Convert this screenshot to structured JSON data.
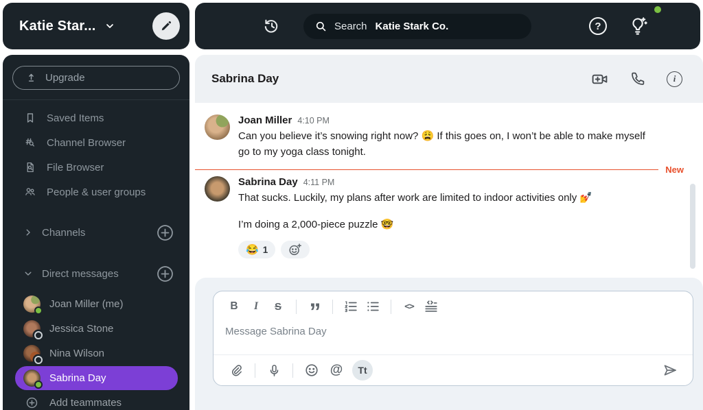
{
  "workspace": {
    "name": "Katie Star..."
  },
  "topbar": {
    "search_label": "Search",
    "search_context": "Katie Stark Co.",
    "help_glyph": "?"
  },
  "sidebar": {
    "upgrade": "Upgrade",
    "items": [
      {
        "label": "Saved Items"
      },
      {
        "label": "Channel Browser"
      },
      {
        "label": "File Browser"
      },
      {
        "label": "People & user groups"
      }
    ],
    "channels_label": "Channels",
    "dms_label": "Direct messages",
    "dms": [
      {
        "name": "Joan Miller (me)",
        "status": "online"
      },
      {
        "name": "Jessica Stone",
        "status": "offline"
      },
      {
        "name": "Nina Wilson",
        "status": "offline"
      },
      {
        "name": "Sabrina Day",
        "status": "online"
      }
    ],
    "add_teammates": "Add teammates"
  },
  "chat": {
    "title": "Sabrina Day",
    "new_label": "New",
    "messages": [
      {
        "author": "Joan Miller",
        "time": "4:10 PM",
        "text": "Can you believe it’s snowing right now? 😩 If this goes on, I won’t be able to make myself go to my yoga class tonight."
      },
      {
        "author": "Sabrina Day",
        "time": "4:11 PM",
        "text1": "That sucks. Luckily, my plans after work are limited to indoor activities only 💅",
        "text2": "I’m doing a 2,000-piece puzzle 🤓",
        "reaction_emoji": "😂",
        "reaction_count": "1"
      }
    ],
    "info_glyph": "i"
  },
  "composer": {
    "toolbar": {
      "bold": "B",
      "italic": "I",
      "strike": "S",
      "quote": "”",
      "code": "<>"
    },
    "placeholder": "Message Sabrina Day",
    "at_label": "@",
    "format_label": "Tt"
  },
  "colors": {
    "dark_panel": "#1b2329",
    "accent_purple": "#7c3fd6",
    "online_green": "#7bc043",
    "new_red": "#e8502c",
    "header_bg": "#eef1f4"
  }
}
